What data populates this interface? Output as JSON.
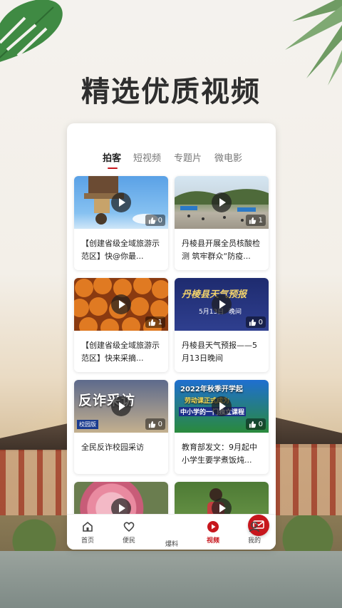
{
  "headline": "精选优质视频",
  "tabs": [
    {
      "label": "拍客",
      "active": true
    },
    {
      "label": "短视频",
      "active": false
    },
    {
      "label": "专题片",
      "active": false
    },
    {
      "label": "微电影",
      "active": false
    }
  ],
  "videos": [
    {
      "title": "【创建省级全域旅游示范区】快@你最...",
      "likes": "0",
      "thumb": "pagoda-sky"
    },
    {
      "title": "丹棱县开展全员核酸检测 筑牢群众“防疫...",
      "likes": "1",
      "thumb": "plaza-tents"
    },
    {
      "title": "【创建省级全域旅游示范区】快来采摘...",
      "likes": "1",
      "thumb": "loquats"
    },
    {
      "title": "丹棱县天气预报——5月13日晚间",
      "likes": "0",
      "thumb": "weather-card"
    },
    {
      "title": "全民反诈校园采访",
      "likes": "0",
      "thumb": "anti-fraud"
    },
    {
      "title": "教育部发文：9月起中小学生要学煮饭炖...",
      "likes": "0",
      "thumb": "school-2022"
    },
    {
      "title": "",
      "likes": "",
      "thumb": "roses"
    },
    {
      "title": "",
      "likes": "",
      "thumb": "garden-kid"
    }
  ],
  "thumb_text": {
    "weather_title": "丹棱县天气预报",
    "weather_date": "5月13日",
    "weather_tag": "晚间",
    "fraud_text": "反诈采访",
    "fraud_tag": "校园版",
    "school_line1": "2022年秋季开学起",
    "school_line2": "劳动课正式成为",
    "school_line3": "中小学的一门独立课程"
  },
  "nav": [
    {
      "label": "首页",
      "icon": "home-icon",
      "active": false
    },
    {
      "label": "便民",
      "icon": "heart-icon",
      "active": false
    },
    {
      "label": "爆料",
      "icon": "mail-icon",
      "active": false
    },
    {
      "label": "视频",
      "icon": "play-circle-icon",
      "active": true
    },
    {
      "label": "我的",
      "icon": "user-icon",
      "active": false
    }
  ],
  "colors": {
    "accent": "#c7161d"
  }
}
